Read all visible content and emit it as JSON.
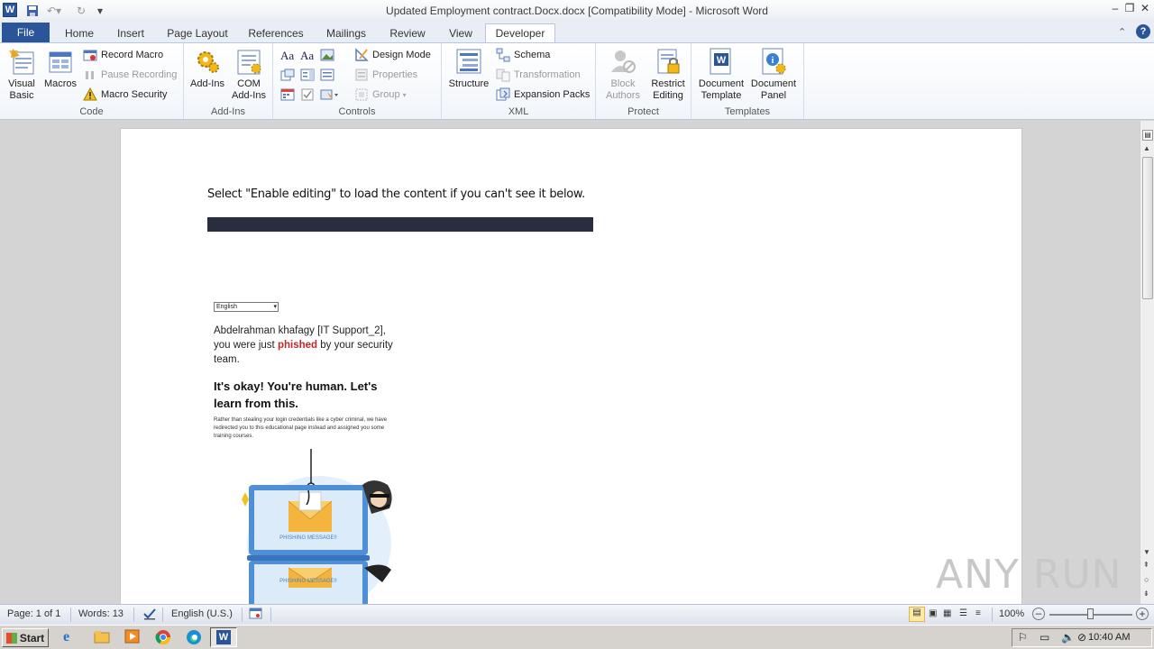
{
  "window": {
    "title": "Updated Employment contract.Docx.docx [Compatibility Mode]  -  Microsoft Word"
  },
  "tabs": {
    "file": "File",
    "items": [
      "Home",
      "Insert",
      "Page Layout",
      "References",
      "Mailings",
      "Review",
      "View",
      "Developer"
    ],
    "active": "Developer"
  },
  "ribbon": {
    "code": {
      "label": "Code",
      "visual_basic": [
        "Visual",
        "Basic"
      ],
      "macros": "Macros",
      "record_macro": "Record Macro",
      "pause_recording": "Pause Recording",
      "macro_security": "Macro Security"
    },
    "addins": {
      "label": "Add-Ins",
      "addins": "Add-Ins",
      "com_addins": [
        "COM",
        "Add-Ins"
      ]
    },
    "controls": {
      "label": "Controls",
      "design_mode": "Design Mode",
      "properties": "Properties",
      "group": "Group"
    },
    "xml": {
      "label": "XML",
      "structure": "Structure",
      "schema": "Schema",
      "transformation": "Transformation",
      "expansion_packs": "Expansion Packs"
    },
    "protect": {
      "label": "Protect",
      "block_authors": [
        "Block",
        "Authors"
      ],
      "restrict_editing": [
        "Restrict",
        "Editing"
      ]
    },
    "templates": {
      "label": "Templates",
      "document_template": [
        "Document",
        "Template"
      ],
      "document_panel": [
        "Document",
        "Panel"
      ]
    }
  },
  "document": {
    "instruction": "Select \"Enable editing\" to load the content if you can't see it below.",
    "language_select": "English",
    "greeting_pre": "Abdelrahman khafagy [IT Support_2], you were just ",
    "greeting_highlight": "phished",
    "greeting_post": " by your security team.",
    "heading": "It's okay! You're human. Let's learn from this.",
    "body": "Rather than stealing your login credentials like a cyber criminal, we have redirected you to this educational page instead and assigned you some training courses.",
    "laptop_label_1": "PHISHING MESSAGE!!",
    "laptop_label_2": "PHISHING MESSAGE!!"
  },
  "statusbar": {
    "page": "Page: 1 of 1",
    "words": "Words: 13",
    "language": "English (U.S.)",
    "zoom": "100%"
  },
  "taskbar": {
    "start": "Start",
    "clock": "10:40 AM"
  },
  "watermark": "ANY RUN",
  "colors": {
    "accent": "#2a5699",
    "phished_red": "#c0282d",
    "dark_bar": "#2a2d3e"
  }
}
